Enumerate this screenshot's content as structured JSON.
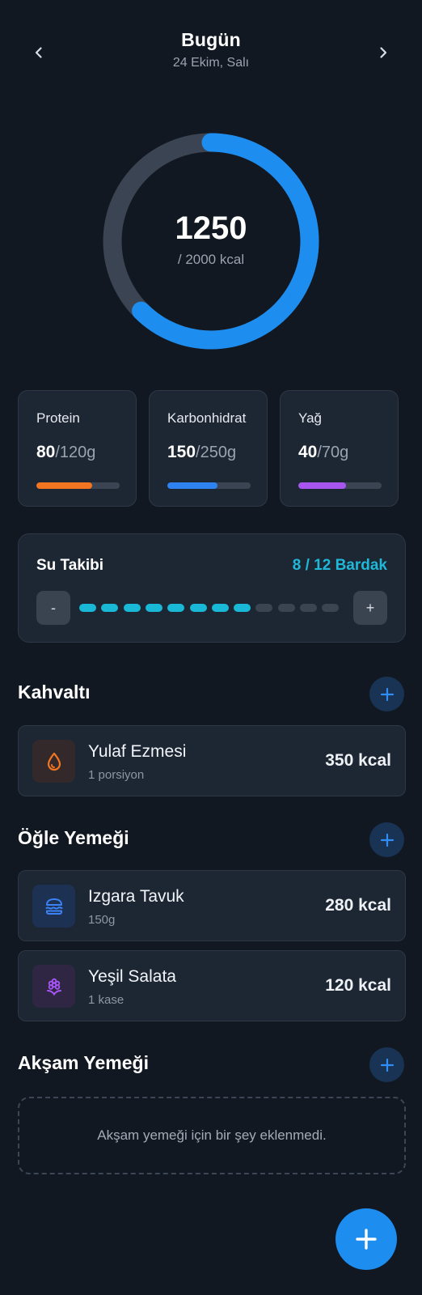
{
  "header": {
    "title": "Bugün",
    "date": "24 Ekim, Salı",
    "prev_icon": "chevron-left-icon",
    "next_icon": "chevron-right-icon"
  },
  "calories": {
    "consumed": "1250",
    "goal_label": "/ 2000 kcal",
    "progress_fraction": 0.625,
    "color": "#1e8df0",
    "track_color": "#3b4452"
  },
  "macros": [
    {
      "name": "Protein",
      "current": "80",
      "target": "/120g",
      "fraction": 0.667,
      "color": "#f27521"
    },
    {
      "name": "Karbonhidrat",
      "current": "150",
      "target": "/250g",
      "fraction": 0.6,
      "color": "#2f83f0"
    },
    {
      "name": "Yağ",
      "current": "40",
      "target": "/70g",
      "fraction": 0.571,
      "color": "#a855f0"
    }
  ],
  "water": {
    "title": "Su Takibi",
    "count_label": "8 / 12 Bardak",
    "filled": 8,
    "total": 12,
    "minus_label": "-",
    "plus_label": "+",
    "filled_color": "#19b8d6",
    "empty_color": "#3b4451"
  },
  "meals": {
    "breakfast": {
      "title": "Kahvaltı",
      "items": [
        {
          "name": "Yulaf Ezmesi",
          "portion": "1 porsiyon",
          "kcal": "350 kcal",
          "icon": "drop-icon",
          "icon_color": "#f27521",
          "icon_bg": "#33292a"
        }
      ]
    },
    "lunch": {
      "title": "Öğle Yemeği",
      "items": [
        {
          "name": "Izgara Tavuk",
          "portion": "150g",
          "kcal": "280 kcal",
          "icon": "burger-icon",
          "icon_color": "#3b82f6",
          "icon_bg": "#1d3152"
        },
        {
          "name": "Yeşil Salata",
          "portion": "1 kase",
          "kcal": "120 kcal",
          "icon": "flower-icon",
          "icon_color": "#a855f7",
          "icon_bg": "#2f2643"
        }
      ]
    },
    "dinner": {
      "title": "Akşam Yemeği",
      "empty_text": "Akşam yemeği için bir şey eklenmedi."
    }
  },
  "fab": {
    "icon": "plus-icon",
    "color": "#1e8df0"
  }
}
